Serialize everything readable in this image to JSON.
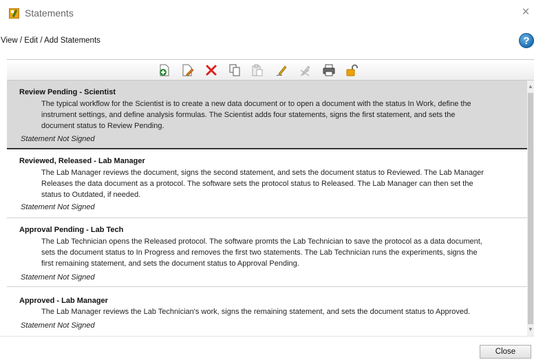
{
  "window": {
    "title": "Statements",
    "close_glyph": "×",
    "subtitle": "View / Edit / Add Statements",
    "help_label": "?"
  },
  "toolbar": {
    "buttons": [
      {
        "name": "add-statement-icon",
        "color": "#2e8b3a"
      },
      {
        "name": "edit-statement-icon",
        "color": "#c0392b"
      },
      {
        "name": "delete-statement-icon",
        "color": "#e02020"
      },
      {
        "name": "copy-icon",
        "color": "#555555"
      },
      {
        "name": "paste-icon",
        "color": "#aaaaaa"
      },
      {
        "name": "sign-icon",
        "color": "#d4a017"
      },
      {
        "name": "unsign-icon",
        "color": "#aaaaaa"
      },
      {
        "name": "print-icon",
        "color": "#4a4a4a"
      },
      {
        "name": "unlock-icon",
        "color": "#f0a000"
      }
    ]
  },
  "statements": [
    {
      "title": "Review Pending - Scientist",
      "lines": [
        "The typical workflow for the Scientist is to create a new data document or to open a document with the status In Work, define the",
        "instrument settings, and define analysis formulas. The Scientist adds four statements, signs the first statement, and sets the",
        "document status to Review Pending."
      ],
      "status": "Statement Not Signed",
      "selected": true
    },
    {
      "title": "Reviewed, Released - Lab Manager",
      "lines": [
        "The Lab Manager reviews the document, signs the second statement, and sets the document status to Reviewed. The Lab Manager",
        "Releases the data document as a protocol. The software sets the protocol status to Released. The Lab Manager can then set the",
        "status to Outdated, if needed."
      ],
      "status": "Statement Not Signed",
      "selected": false
    },
    {
      "title": "Approval Pending - Lab Tech",
      "lines": [
        "The Lab Technician opens the Released protocol. The software promts the Lab Technician to save the protocol as a data document,",
        "sets the document status to In Progress and removes the first two statements. The Lab Technician runs the experiments, signs the",
        "first remaining statement, and sets the document status to Approval Pending."
      ],
      "status": "Statement Not Signed",
      "selected": false
    },
    {
      "title": "Approved - Lab Manager",
      "lines": [
        "The Lab Manager reviews the Lab Technician's work, signs the remaining statement, and sets the document status to Approved."
      ],
      "status": "Statement Not Signed",
      "selected": false
    }
  ],
  "footer": {
    "close_label": "Close"
  },
  "colors": {
    "selection": "#d9d9d9",
    "help": "#1c6fb3"
  }
}
